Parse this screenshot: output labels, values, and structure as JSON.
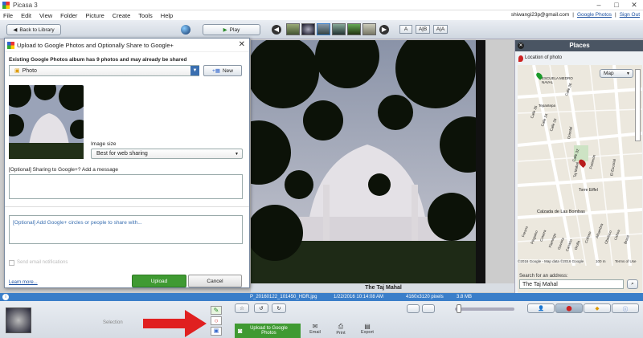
{
  "window": {
    "title": "Picasa 3",
    "controls": [
      "–",
      "□",
      "✕"
    ]
  },
  "menu": {
    "items": [
      "File",
      "Edit",
      "View",
      "Folder",
      "Picture",
      "Create",
      "Tools",
      "Help"
    ],
    "account": "shiwangi23p@gmail.com",
    "separator1": "|",
    "google_photos": "Google Photos",
    "separator2": "|",
    "sign_out": "Sign Out"
  },
  "toolbar": {
    "back_label": "Back to Library",
    "play_label": "Play",
    "view_buttons": [
      "A",
      "A|B",
      "A|A"
    ]
  },
  "dialog": {
    "title": "Upload to Google Photos and Optionally Share to Google+",
    "album_info": "Existing Google Photos album has 9 photos and may already be shared",
    "album_value": "Photo",
    "new_label": "New",
    "image_size_label": "Image size",
    "image_size_value": "Best for web sharing",
    "message_label": "[Optional] Sharing to Google+? Add a message",
    "circles_placeholder": "[Optional] Add Google+ circles or people to share with...",
    "email_notif_label": "Send email notifications",
    "learn_more": "Learn more...",
    "upload_label": "Upload",
    "cancel_label": "Cancel"
  },
  "places": {
    "title": "Places",
    "location_label": "Location of photo",
    "map_type": "Map",
    "map_streets": [
      "ESCUELA MEDRO NAVAL",
      "Tepantepa",
      "Calle 36",
      "Oriental",
      "Calle 35",
      "Calle 34",
      "Calle 33",
      "Calle 32",
      "Partenón",
      "Torre Eiffel",
      "El Escorial",
      "Taj Mahal",
      "Calzada de Las Bombas",
      "Fresno",
      "Pinguino",
      "Alhambra",
      "Cotorra",
      "Lisboa",
      "Flamingo",
      "Coliseo",
      "Obelisco",
      "Gaviota",
      "Canario",
      "Grulla",
      "Brasil"
    ],
    "map_copyright": "©2016 Google - Map data ©2016 Google",
    "map_scale": "100 m",
    "map_terms": "Terms of Use",
    "search_label": "Search for an address:",
    "search_value": "The Taj Mahal"
  },
  "photo": {
    "caption": "The Taj Mahal"
  },
  "status": {
    "filename": "P_20160122_101450_HDR.jpg",
    "date": "1/22/2016 10:14:08 AM",
    "dimensions": "4160x3120 pixels",
    "size": "3.8 MB"
  },
  "bottom": {
    "selection_label": "Selection",
    "upload_google_label": "Upload to Google Photos",
    "actions": [
      "Email",
      "Print",
      "Export"
    ]
  },
  "colors": {
    "accent_blue": "#3a7ec9",
    "upload_green": "#3f9a32",
    "arrow_red": "#e02020"
  }
}
